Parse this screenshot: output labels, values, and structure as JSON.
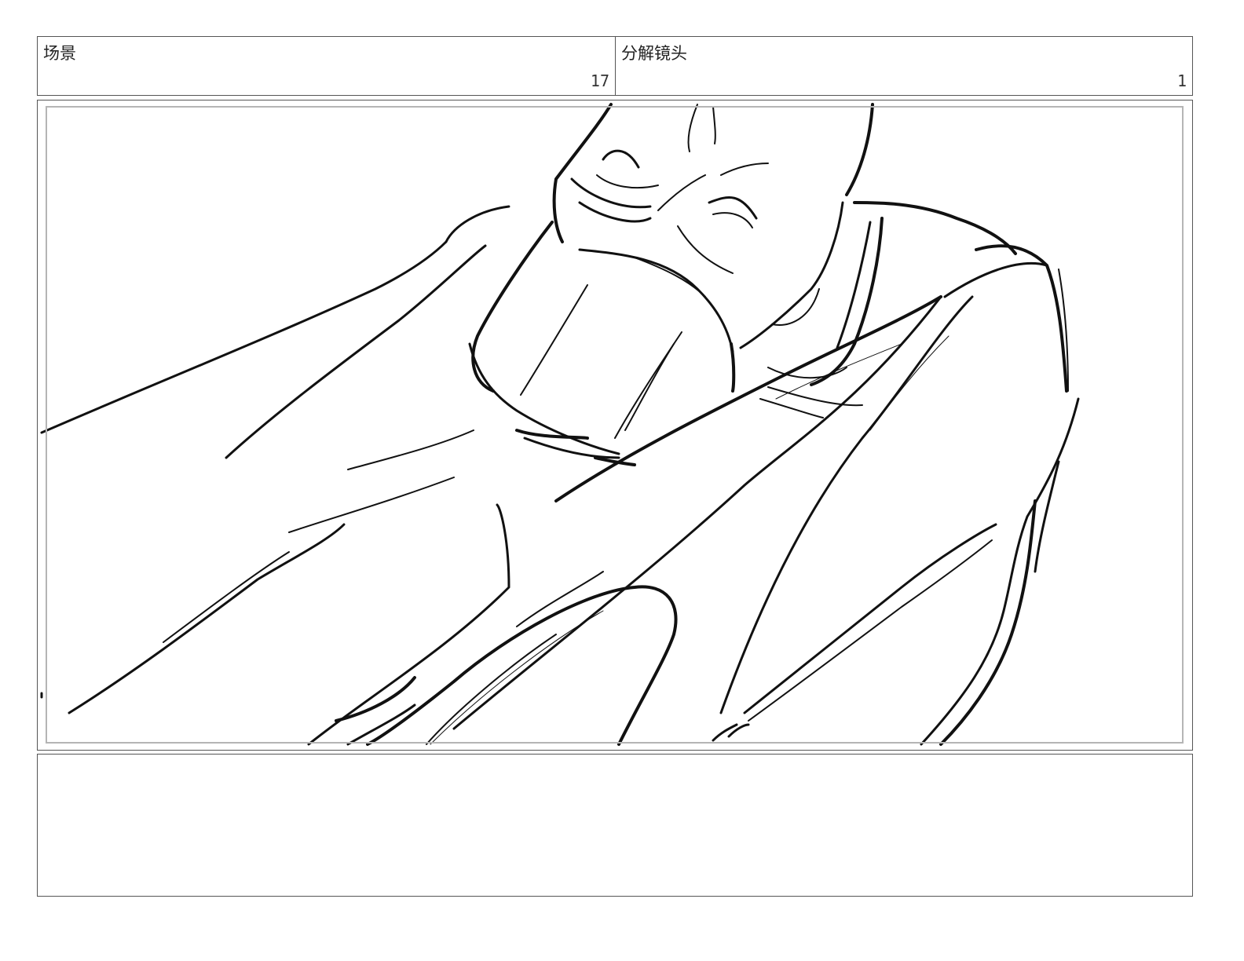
{
  "header": {
    "scene_label": "场景",
    "scene_number": "17",
    "shot_label": "分解镜头",
    "shot_number": "1"
  },
  "panel": {
    "image_subject": "sketch-figure-lying",
    "line_color": "#111111",
    "safe_area_color": "#b5b5b5"
  },
  "notes": {
    "text": ""
  }
}
